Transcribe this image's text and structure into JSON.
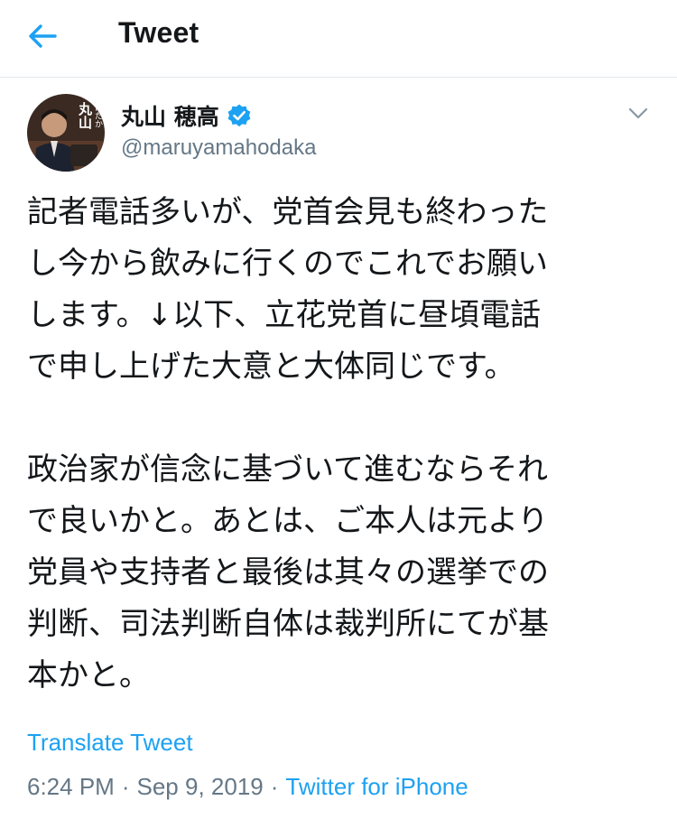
{
  "header": {
    "title": "Tweet",
    "back_icon": "arrow-left-icon"
  },
  "tweet": {
    "author": {
      "name": "丸山 穂高",
      "handle": "@maruyamahodaka",
      "verified": true,
      "avatar_text": "丸山",
      "avatar_subtext": "ほだか"
    },
    "text": "記者電話多いが、党首会見も終わった\nし今から飲みに行くのでこれでお願い\nします。↓以下、立花党首に昼頃電話\nで申し上げた大意と大体同じです。\n\n政治家が信念に基づいて進むならそれ\nで良いかと。あとは、ご本人は元より\n党員や支持者と最後は其々の選挙での\n判断、司法判断自体は裁判所にてが基\n本かと。",
    "translate_label": "Translate Tweet",
    "time": "6:24 PM",
    "separator": "·",
    "date": "Sep 9, 2019",
    "source": "Twitter for iPhone"
  },
  "colors": {
    "accent": "#1da1f2",
    "secondary_text": "#657786",
    "primary_text": "#14171a",
    "divider": "#e1e8ed"
  }
}
